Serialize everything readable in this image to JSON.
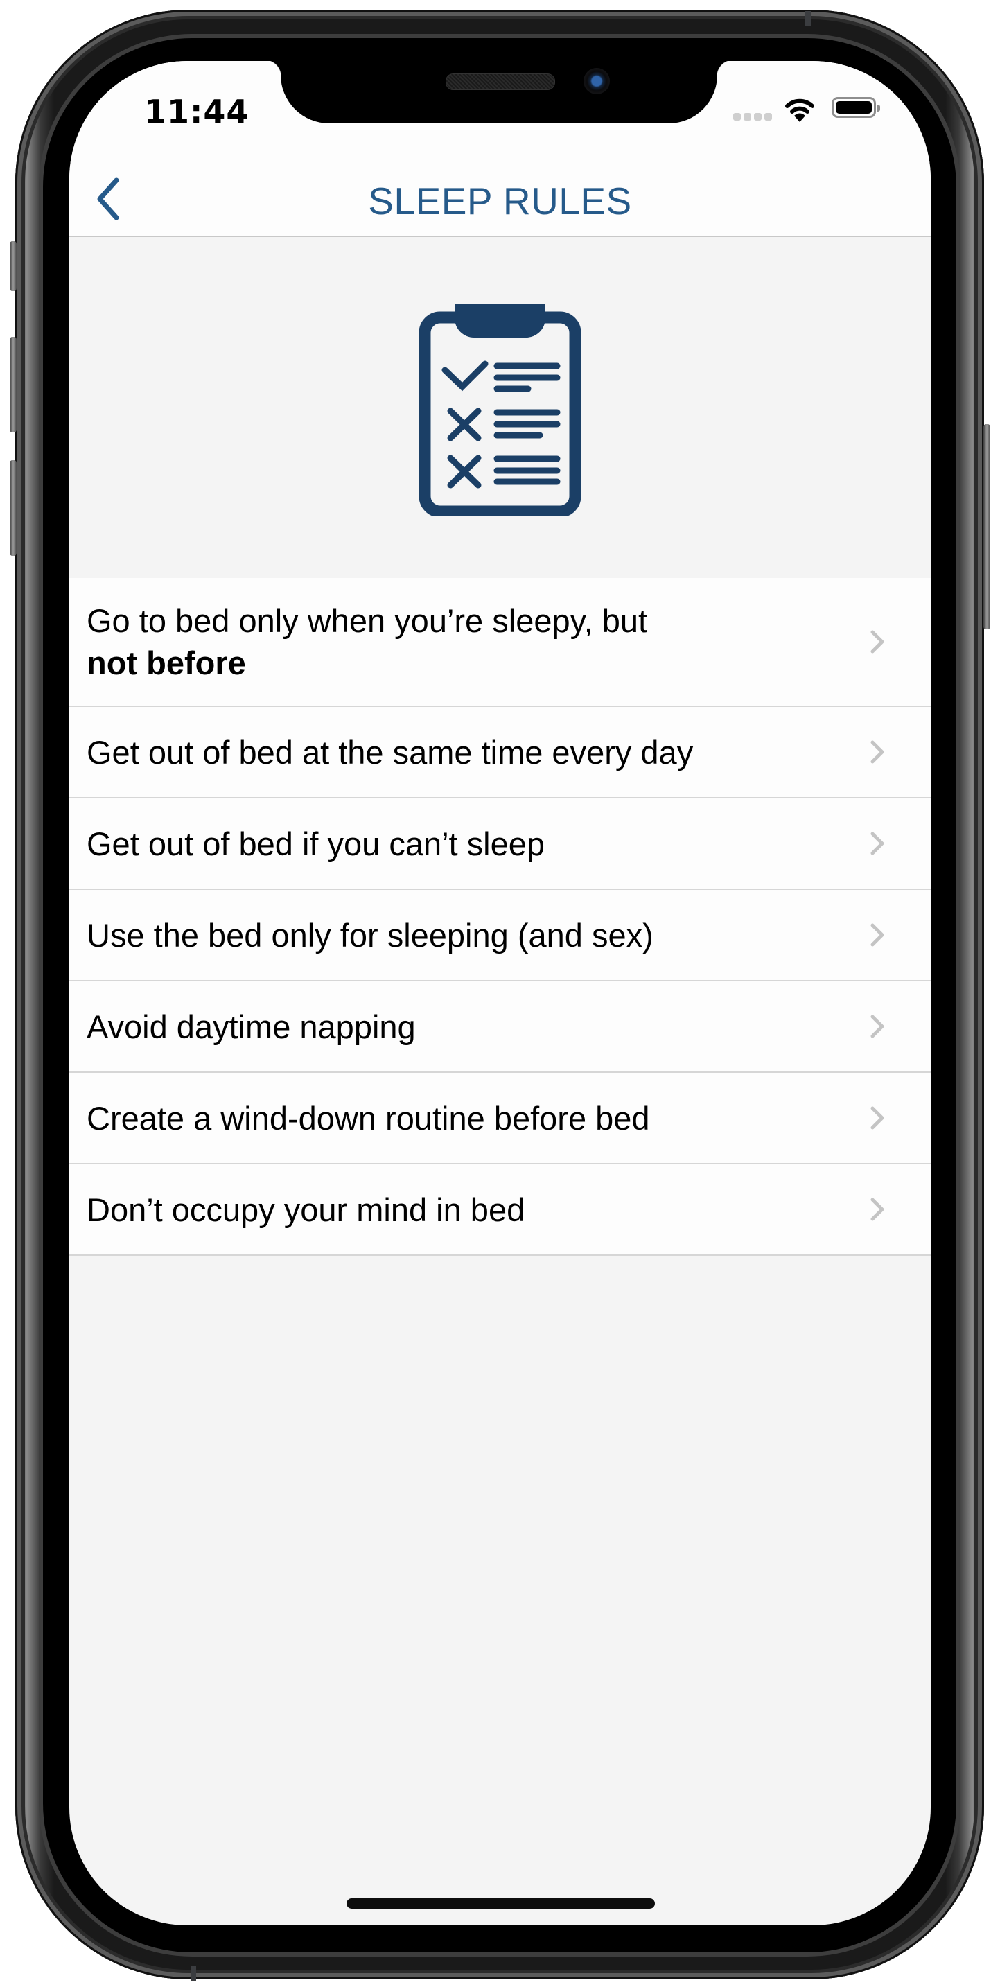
{
  "status_bar": {
    "time": "11:44",
    "icons": [
      "signal-dots-icon",
      "wifi-icon",
      "battery-full-icon"
    ]
  },
  "navbar": {
    "back_icon": "chevron-left-icon",
    "title": "SLEEP RULES"
  },
  "hero": {
    "icon": "clipboard-checklist-icon"
  },
  "colors": {
    "accent": "#265a8a",
    "icon_navy": "#1b3f66",
    "chevron": "#c4c4c4",
    "divider": "#d6d6d6",
    "background": "#f4f4f4"
  },
  "rules": [
    {
      "label": "Go to bed only when you’re sleepy, but",
      "label_bold": "not before"
    },
    {
      "label": "Get out of bed at the same time every day"
    },
    {
      "label": "Get out of bed if you can’t sleep"
    },
    {
      "label": "Use the bed only for sleeping (and sex)"
    },
    {
      "label": "Avoid daytime napping"
    },
    {
      "label": "Create a wind-down routine before bed"
    },
    {
      "label": "Don’t occupy your mind in bed"
    }
  ]
}
